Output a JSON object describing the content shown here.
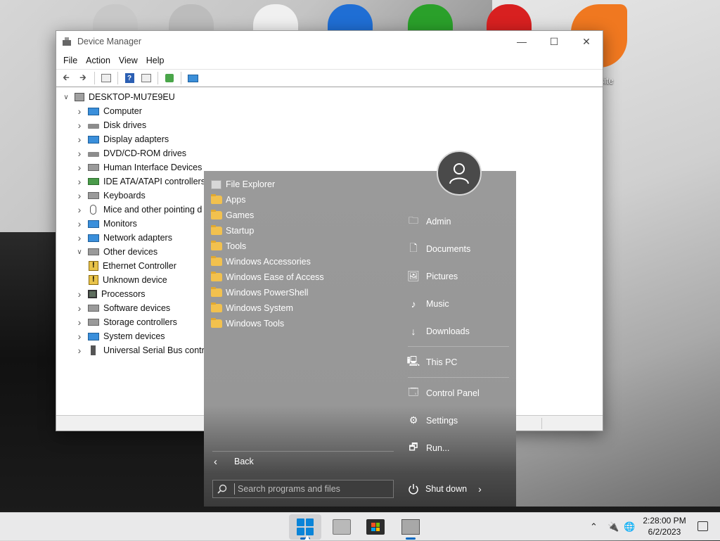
{
  "desktop": {
    "icon_label": "osite"
  },
  "device_manager": {
    "title": "Device Manager",
    "menu": [
      "File",
      "Action",
      "View",
      "Help"
    ],
    "tree": {
      "root": "DESKTOP-MU7E9EU",
      "nodes": [
        {
          "label": "Computer",
          "icon": "computer-icon"
        },
        {
          "label": "Disk drives",
          "icon": "disk-drive-icon"
        },
        {
          "label": "Display adapters",
          "icon": "display-adapter-icon"
        },
        {
          "label": "DVD/CD-ROM drives",
          "icon": "dvd-drive-icon"
        },
        {
          "label": "Human Interface Devices",
          "icon": "hid-icon"
        },
        {
          "label": "IDE ATA/ATAPI controllers",
          "icon": "ide-controller-icon"
        },
        {
          "label": "Keyboards",
          "icon": "keyboard-icon"
        },
        {
          "label": "Mice and other pointing d",
          "icon": "mouse-icon"
        },
        {
          "label": "Monitors",
          "icon": "monitor-icon"
        },
        {
          "label": "Network adapters",
          "icon": "network-adapter-icon"
        },
        {
          "label": "Other devices",
          "icon": "unknown-device-icon",
          "expanded": true
        },
        {
          "label": "Ethernet Controller",
          "icon": "warning-device-icon",
          "child": true
        },
        {
          "label": "Unknown device",
          "icon": "warning-device-icon",
          "child": true
        },
        {
          "label": "Processors",
          "icon": "processor-icon"
        },
        {
          "label": "Software devices",
          "icon": "software-device-icon"
        },
        {
          "label": "Storage controllers",
          "icon": "storage-controller-icon"
        },
        {
          "label": "System devices",
          "icon": "system-device-icon"
        },
        {
          "label": "Universal Serial Bus contro",
          "icon": "usb-icon"
        }
      ]
    }
  },
  "start_menu": {
    "left_items": [
      {
        "label": "File Explorer",
        "icon": "file-explorer-icon"
      },
      {
        "label": "Apps",
        "icon": "folder-icon"
      },
      {
        "label": "Games",
        "icon": "folder-icon"
      },
      {
        "label": "Startup",
        "icon": "folder-icon"
      },
      {
        "label": "Tools",
        "icon": "folder-icon"
      },
      {
        "label": "Windows Accessories",
        "icon": "folder-icon"
      },
      {
        "label": "Windows Ease of Access",
        "icon": "folder-icon"
      },
      {
        "label": "Windows PowerShell",
        "icon": "folder-icon"
      },
      {
        "label": "Windows System",
        "icon": "folder-icon"
      },
      {
        "label": "Windows Tools",
        "icon": "folder-icon"
      }
    ],
    "right_items": [
      {
        "label": "Admin",
        "icon": "user-folder-icon"
      },
      {
        "label": "Documents",
        "icon": "document-icon"
      },
      {
        "label": "Pictures",
        "icon": "picture-icon"
      },
      {
        "label": "Music",
        "icon": "music-icon"
      },
      {
        "label": "Downloads",
        "icon": "download-icon"
      },
      {
        "label": "This PC",
        "icon": "this-pc-icon"
      },
      {
        "label": "Control Panel",
        "icon": "control-panel-icon"
      },
      {
        "label": "Settings",
        "icon": "gear-icon"
      },
      {
        "label": "Run...",
        "icon": "run-icon"
      }
    ],
    "back_label": "Back",
    "search_placeholder": "Search programs and files",
    "shutdown_label": "Shut down"
  },
  "taskbar": {
    "time": "2:28:00 PM",
    "date": "6/2/2023"
  }
}
